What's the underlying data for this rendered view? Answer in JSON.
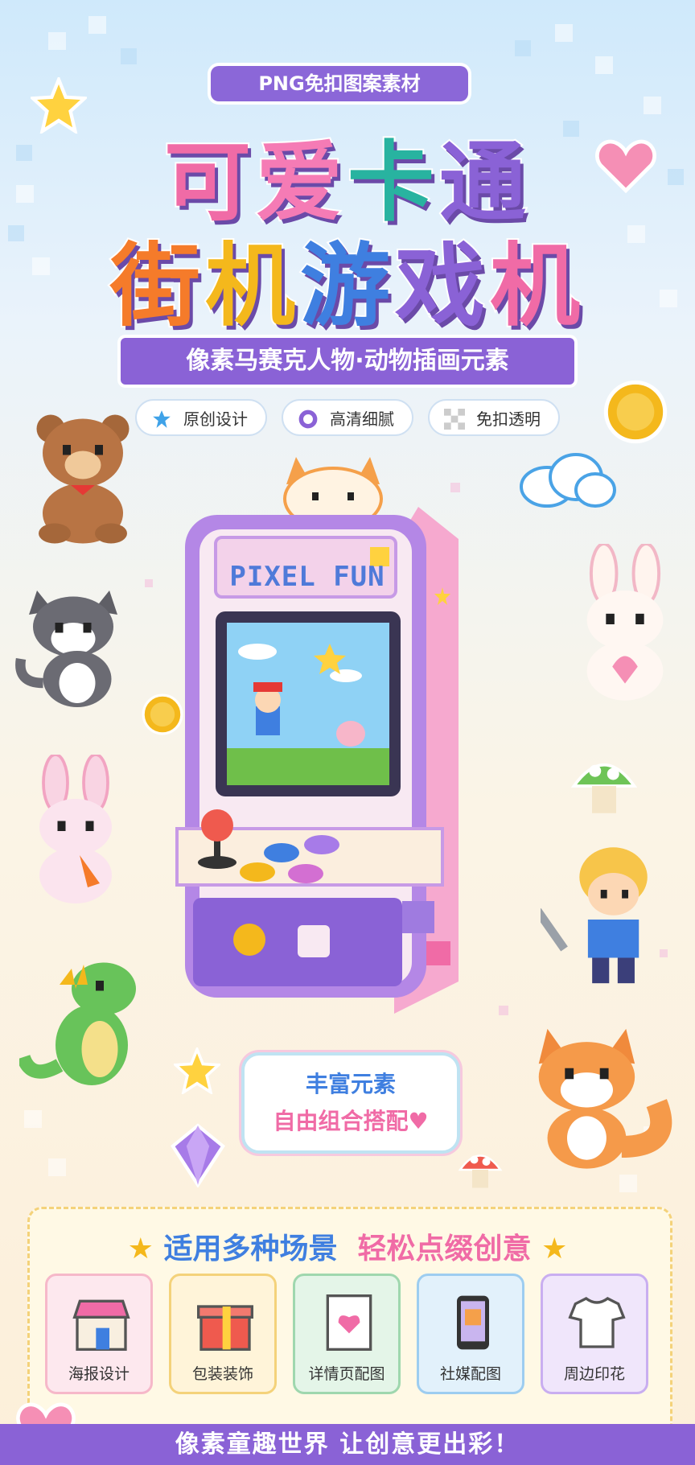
{
  "header": {
    "tag": "PNG免扣图案素材",
    "title_line1": [
      "可",
      "爱",
      "卡",
      "通"
    ],
    "title_line2": [
      "街",
      "机",
      "游",
      "戏",
      "机"
    ],
    "subtitle": "像素马赛克人物·动物插画元素"
  },
  "features": [
    {
      "label": "原创设计",
      "icon": "star-icon"
    },
    {
      "label": "高清细腻",
      "icon": "ring-icon"
    },
    {
      "label": "免扣透明",
      "icon": "checker-icon"
    }
  ],
  "arcade": {
    "marquee": "PIXEL FUN"
  },
  "bubble": {
    "line1": "丰富元素",
    "line2": "自由组合搭配♥"
  },
  "scenes": {
    "title_left": "适用多种场景",
    "title_right": "轻松点缀创意",
    "items": [
      {
        "label": "海报设计",
        "icon": "shop-icon"
      },
      {
        "label": "包装装饰",
        "icon": "gift-icon"
      },
      {
        "label": "详情页配图",
        "icon": "notebook-icon"
      },
      {
        "label": "社媒配图",
        "icon": "phone-icon"
      },
      {
        "label": "周边印花",
        "icon": "tshirt-icon"
      }
    ]
  },
  "footer": {
    "text": "像素童趣世界  让创意更出彩！"
  },
  "colors": {
    "purple": "#8a62d6",
    "pink": "#f06ba6",
    "orange": "#f57b2a",
    "yellow": "#f4b81c",
    "teal": "#28b3a0",
    "blue": "#3f7fe0"
  }
}
